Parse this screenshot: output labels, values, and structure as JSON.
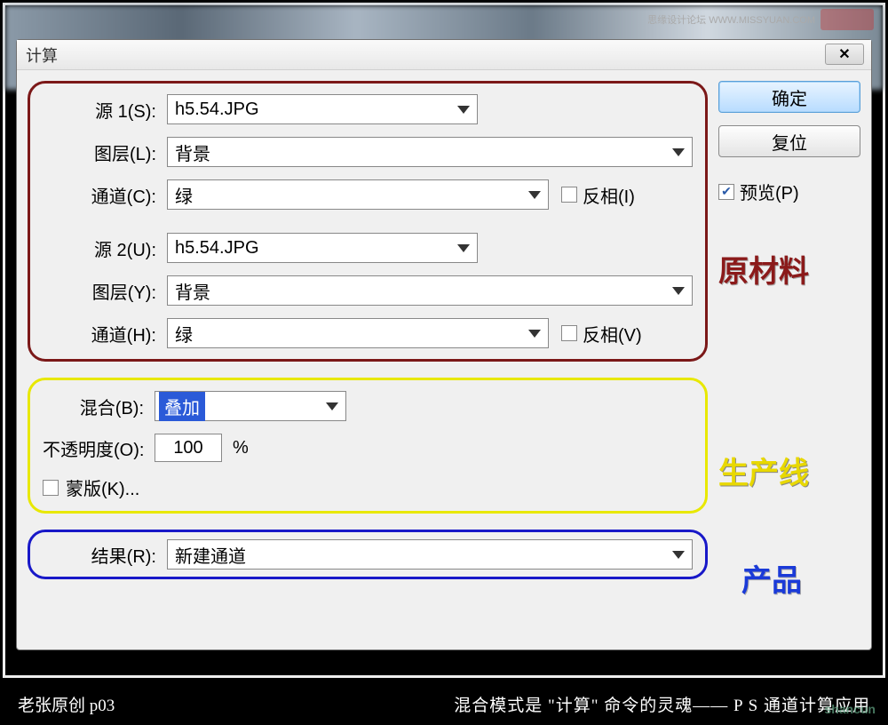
{
  "watermark": {
    "top_text": "思缘设计论坛  WWW.MISSYUAN.COM",
    "bottom_text": "shancun"
  },
  "dialog": {
    "title": "计算",
    "close": "✕",
    "ok": "确定",
    "reset": "复位",
    "preview_label": "预览(P)",
    "preview_checked": true
  },
  "source1": {
    "label": "源 1(S):",
    "value": "h5.54.JPG",
    "layer_label": "图层(L):",
    "layer_value": "背景",
    "channel_label": "通道(C):",
    "channel_value": "绿",
    "invert_label": "反相(I)"
  },
  "source2": {
    "label": "源 2(U):",
    "value": "h5.54.JPG",
    "layer_label": "图层(Y):",
    "layer_value": "背景",
    "channel_label": "通道(H):",
    "channel_value": "绿",
    "invert_label": "反相(V)"
  },
  "blend": {
    "label": "混合(B):",
    "value": "叠加",
    "opacity_label": "不透明度(O):",
    "opacity_value": "100",
    "opacity_pct": "%",
    "mask_label": "蒙版(K)..."
  },
  "result": {
    "label": "结果(R):",
    "value": "新建通道"
  },
  "annotations": {
    "raw": "原材料",
    "pipeline": "生产线",
    "product": "产品"
  },
  "footer": {
    "left": "老张原创    p03",
    "right": "混合模式是 \"计算\" 命令的灵魂——  P S 通道计算应用"
  }
}
